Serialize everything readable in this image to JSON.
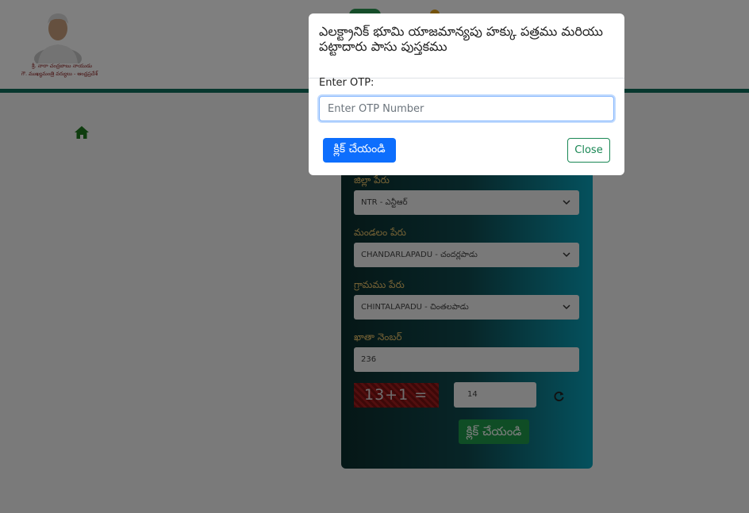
{
  "header": {
    "caption_line1": "శ్రీ. నారా చంద్రబాబు నాయుడు",
    "caption_line2": "గౌ. ముఖ్యమంత్రి వర్యులు - ఆంధ్రప్రదేశ్",
    "portrait_icon": "portrait-icon"
  },
  "nav": {
    "home_icon": "home-icon"
  },
  "form": {
    "district_label": "జిల్లా పేరు",
    "district_value": "NTR - ఎన్టీఆర్",
    "mandal_label": "మండలం పేరు",
    "mandal_value": "CHANDARLAPADU - చందర్లపాడు",
    "village_label": "గ్రామము పేరు",
    "village_value": "CHINTALAPADU - చింతలపాడు",
    "khata_label": "ఖాతా నెంబర్",
    "khata_value": "236",
    "captcha_text": "13+1 =",
    "captcha_answer": "14",
    "submit_label": "క్లిక్ చేయండి",
    "colors": {
      "label": "#eac36a",
      "submit": "#1e9a4a"
    }
  },
  "modal": {
    "title": "ఎలక్ట్రానిక్ భూమి యాజమాన్యపు హక్కు పత్రము మరియు పట్టాదారు పాసు పుస్తకము",
    "otp_label": "Enter OTP:",
    "otp_placeholder": "Enter OTP Number",
    "otp_value": "",
    "submit_label": "క్లిక్ చేయండి",
    "close_label": "Close",
    "colors": {
      "primary": "#0d6efd",
      "close": "#198754"
    }
  }
}
